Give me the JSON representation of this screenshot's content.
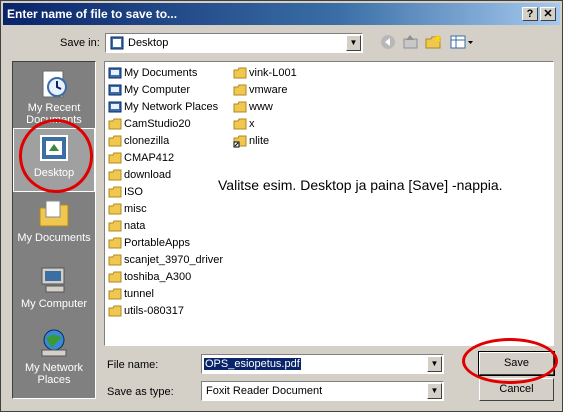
{
  "window": {
    "title": "Enter name of file to save to..."
  },
  "title_buttons": {
    "help": "?",
    "close": "✕"
  },
  "save_in": {
    "label": "Save in:",
    "value": "Desktop"
  },
  "places": [
    {
      "label": "My Recent Documents",
      "icon": "recent-documents-icon"
    },
    {
      "label": "Desktop",
      "icon": "desktop-icon"
    },
    {
      "label": "My Documents",
      "icon": "my-documents-icon"
    },
    {
      "label": "My Computer",
      "icon": "my-computer-icon"
    },
    {
      "label": "My Network Places",
      "icon": "network-places-icon"
    }
  ],
  "files_col1": [
    {
      "name": "My Documents",
      "type": "special"
    },
    {
      "name": "My Computer",
      "type": "special"
    },
    {
      "name": "My Network Places",
      "type": "special"
    },
    {
      "name": "CamStudio20",
      "type": "folder"
    },
    {
      "name": "clonezilla",
      "type": "folder"
    },
    {
      "name": "CMAP412",
      "type": "folder"
    },
    {
      "name": "download",
      "type": "folder"
    },
    {
      "name": "ISO",
      "type": "folder"
    },
    {
      "name": "misc",
      "type": "folder"
    },
    {
      "name": "nata",
      "type": "folder"
    },
    {
      "name": "PortableApps",
      "type": "folder"
    },
    {
      "name": "scanjet_3970_driver",
      "type": "folder"
    },
    {
      "name": "toshiba_A300",
      "type": "folder"
    },
    {
      "name": "tunnel",
      "type": "folder"
    },
    {
      "name": "utils-080317",
      "type": "folder"
    }
  ],
  "files_col2": [
    {
      "name": "vink-L001",
      "type": "folder"
    },
    {
      "name": "vmware",
      "type": "folder"
    },
    {
      "name": "www",
      "type": "folder"
    },
    {
      "name": "x",
      "type": "folder"
    },
    {
      "name": "nlite",
      "type": "shortcut"
    }
  ],
  "annotation": "Valitse esim. Desktop ja paina [Save] -nappia.",
  "file_name": {
    "label": "File name:",
    "value": "OPS_esiopetus.pdf"
  },
  "save_as_type": {
    "label": "Save as type:",
    "value": "Foxit Reader Document"
  },
  "buttons": {
    "save": "Save",
    "cancel": "Cancel"
  },
  "colors": {
    "titlebar": "#0a246a",
    "dialog": "#d4d0c8",
    "places_bar": "#808080",
    "highlight_circle": "#e00000",
    "folder": "#f0c850"
  }
}
